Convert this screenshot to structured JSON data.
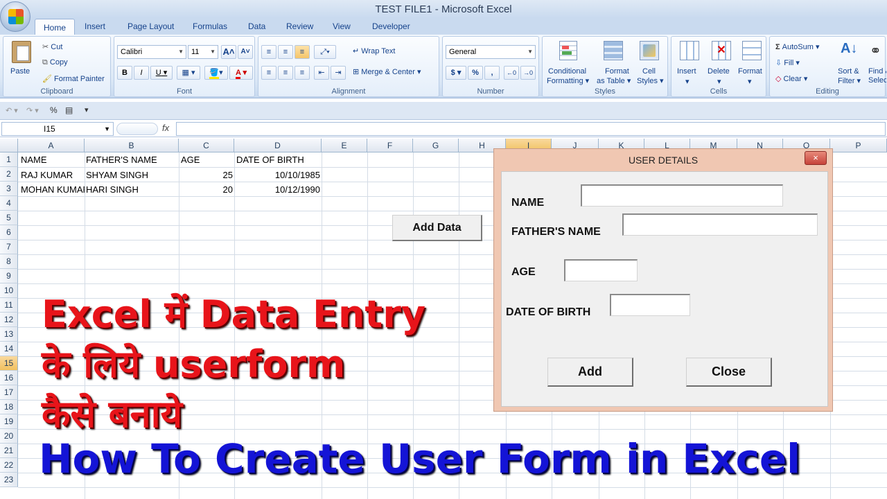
{
  "window": {
    "title": "TEST FILE1 - Microsoft Excel"
  },
  "tabs": [
    "Home",
    "Insert",
    "Page Layout",
    "Formulas",
    "Data",
    "Review",
    "View",
    "Developer"
  ],
  "ribbon": {
    "clipboard": {
      "label": "Clipboard",
      "paste": "Paste",
      "cut": "Cut",
      "copy": "Copy",
      "format_painter": "Format Painter"
    },
    "font": {
      "label": "Font",
      "name": "Calibri",
      "size": "11",
      "bold": "B",
      "italic": "I",
      "underline": "U",
      "grow": "A",
      "shrink": "A"
    },
    "alignment": {
      "label": "Alignment",
      "wrap_text": "Wrap Text",
      "merge_center": "Merge & Center"
    },
    "number": {
      "label": "Number",
      "format": "General",
      "currency": "$",
      "percent": "%",
      "comma": ","
    },
    "styles": {
      "label": "Styles",
      "conditional": "Conditional",
      "conditional2": "Formatting",
      "format_table": "Format",
      "format_table2": "as Table",
      "cell_styles": "Cell",
      "cell_styles2": "Styles"
    },
    "cells": {
      "label": "Cells",
      "insert": "Insert",
      "delete": "Delete",
      "format": "Format"
    },
    "editing": {
      "label": "Editing",
      "autosum": "AutoSum",
      "fill": "Fill",
      "clear": "Clear",
      "sort": "Sort &",
      "sort2": "Filter",
      "find": "Find &",
      "find2": "Select"
    }
  },
  "formula_bar": {
    "name_box": "I15",
    "fx": "fx",
    "value": ""
  },
  "columns": [
    "A",
    "B",
    "C",
    "D",
    "E",
    "F",
    "G",
    "H",
    "I",
    "J",
    "K",
    "L",
    "M",
    "N",
    "O",
    "P"
  ],
  "rows": [
    "1",
    "2",
    "3",
    "4",
    "5",
    "6",
    "7",
    "8",
    "9",
    "10",
    "11",
    "12",
    "13",
    "14",
    "15",
    "16",
    "17",
    "18",
    "19",
    "20",
    "21",
    "22",
    "23"
  ],
  "sheet": {
    "headers": [
      "NAME",
      "FATHER'S NAME",
      "AGE",
      "DATE OF BIRTH"
    ],
    "records": [
      {
        "name": "RAJ KUMAR",
        "father": "SHYAM SINGH",
        "age": "25",
        "dob": "10/10/1985"
      },
      {
        "name": "MOHAN KUMAR",
        "father": "HARI SINGH",
        "age": "20",
        "dob": "10/12/1990"
      }
    ]
  },
  "add_data_button": "Add Data",
  "overlay": {
    "line1": "Excel में  Data Entry",
    "line2": "के  लिये  userform",
    "line3": "कैसे  बनाये",
    "line4": "How To Create User Form in Excel"
  },
  "userform": {
    "title": "USER DETAILS",
    "close_x": "×",
    "name_label": "NAME",
    "father_label": "FATHER'S NAME",
    "age_label": "AGE",
    "dob_label": "DATE OF BIRTH",
    "add_button": "Add",
    "close_button": "Close"
  },
  "colors": {
    "selection": "#f1c15f",
    "form_border": "#f0c7b2",
    "overlay_red": "#e8141a",
    "overlay_blue": "#1414d6"
  }
}
